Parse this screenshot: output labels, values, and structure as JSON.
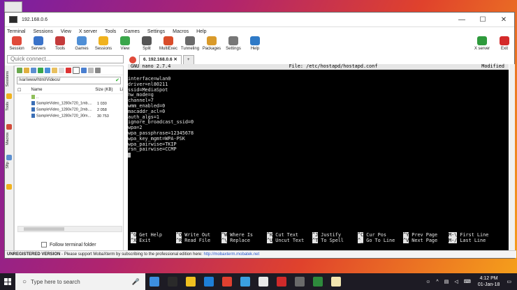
{
  "window": {
    "title": "192.168.0.6",
    "controls": [
      "—",
      "☐",
      "✕"
    ]
  },
  "menu": [
    "Terminal",
    "Sessions",
    "View",
    "X server",
    "Tools",
    "Games",
    "Settings",
    "Macros",
    "Help"
  ],
  "toolbar": [
    {
      "label": "Session",
      "color": "#e04a3a"
    },
    {
      "label": "Servers",
      "color": "#3a73c9"
    },
    {
      "label": "Tools",
      "color": "#c43b3b"
    },
    {
      "label": "Games",
      "color": "#4f8fd6"
    },
    {
      "label": "Sessions",
      "color": "#f0b21e"
    },
    {
      "label": "View",
      "color": "#3aa64a"
    },
    {
      "label": "Split",
      "color": "#555555"
    },
    {
      "label": "MultiExec",
      "color": "#d94d2a"
    },
    {
      "label": "Tunneling",
      "color": "#6a6a6a"
    },
    {
      "label": "Packages",
      "color": "#d99a2a"
    },
    {
      "label": "Settings",
      "color": "#777777"
    },
    {
      "label": "Help",
      "color": "#2f7ac7"
    }
  ],
  "toolbar_right": [
    {
      "label": "X server",
      "color": "#2e9a3c"
    },
    {
      "label": "Exit",
      "color": "#d42a2a"
    }
  ],
  "quick_connect": {
    "placeholder": "Quick connect..."
  },
  "side_tabs": [
    "Sessions",
    "Tools",
    "Macros",
    "Sftp"
  ],
  "sftp": {
    "path": "/var/www/html/Videos/",
    "columns": [
      "Name",
      "Size (KB)",
      "Li"
    ],
    "rows": [
      {
        "name": "..",
        "size": ""
      },
      {
        "name": "SampleVideo_1280x720_1mb....",
        "size": "1 030"
      },
      {
        "name": "SampleVideo_1280x720_2mb....",
        "size": "2 058"
      },
      {
        "name": "SampleVideo_1280x720_30m...",
        "size": "30 753"
      }
    ],
    "follow_label": "Follow terminal folder"
  },
  "tabs": [
    {
      "label": "6. 192.168.0.6",
      "active": true
    }
  ],
  "nano": {
    "version": "GNU nano 2.7.4",
    "file": "File: /etc/hostapd/hostapd.conf",
    "status": "Modified",
    "lines": [
      "interface=wlan0",
      "driver=nl80211",
      "ssid=MediaSpot",
      "hw_mode=g",
      "channel=7",
      "wmm_enabled=0",
      "macaddr_acl=0",
      "auth_algs=1",
      "ignore_broadcast_ssid=0",
      "wpa=2",
      "wpa_passphrase=12345678",
      "wpa_key_mgmt=WPA-PSK",
      "wpa_pairwise=TKIP",
      "rsn_pairwise=CCMP"
    ],
    "shortcuts": [
      [
        {
          "key": "^G",
          "label": "Get Help"
        },
        {
          "key": "^X",
          "label": "Exit"
        }
      ],
      [
        {
          "key": "^O",
          "label": "Write Out"
        },
        {
          "key": "^R",
          "label": "Read File"
        }
      ],
      [
        {
          "key": "^W",
          "label": "Where Is"
        },
        {
          "key": "^\\",
          "label": "Replace"
        }
      ],
      [
        {
          "key": "^K",
          "label": "Cut Text"
        },
        {
          "key": "^U",
          "label": "Uncut Text"
        }
      ],
      [
        {
          "key": "^J",
          "label": "Justify"
        },
        {
          "key": "^T",
          "label": "To Spell"
        }
      ],
      [
        {
          "key": "^C",
          "label": "Cur Pos"
        },
        {
          "key": "^_",
          "label": "Go To Line"
        }
      ],
      [
        {
          "key": "^Y",
          "label": "Prev Page"
        },
        {
          "key": "^V",
          "label": "Next Page"
        }
      ],
      [
        {
          "key": "M-\\",
          "label": "First Line"
        },
        {
          "key": "M-/",
          "label": "Last Line"
        }
      ]
    ]
  },
  "status": {
    "bold": "UNREGISTERED VERSION",
    "text": " - Please support MobaXterm by subscribing to the professional edition here: ",
    "link": "http://mobaxterm.mobatek.net"
  },
  "taskbar": {
    "search_placeholder": "Type here to search",
    "apps": [
      "#3d8fe0",
      "#2a2a2a",
      "#f0c020",
      "#1e7fd8",
      "#e04030",
      "#3aa0e0",
      "#e8e8e8",
      "#d02a2a",
      "#6a6a6a",
      "#2e8a3c",
      "#f2e6b0"
    ],
    "time": "4:12 PM",
    "date": "01-Jan-18"
  }
}
